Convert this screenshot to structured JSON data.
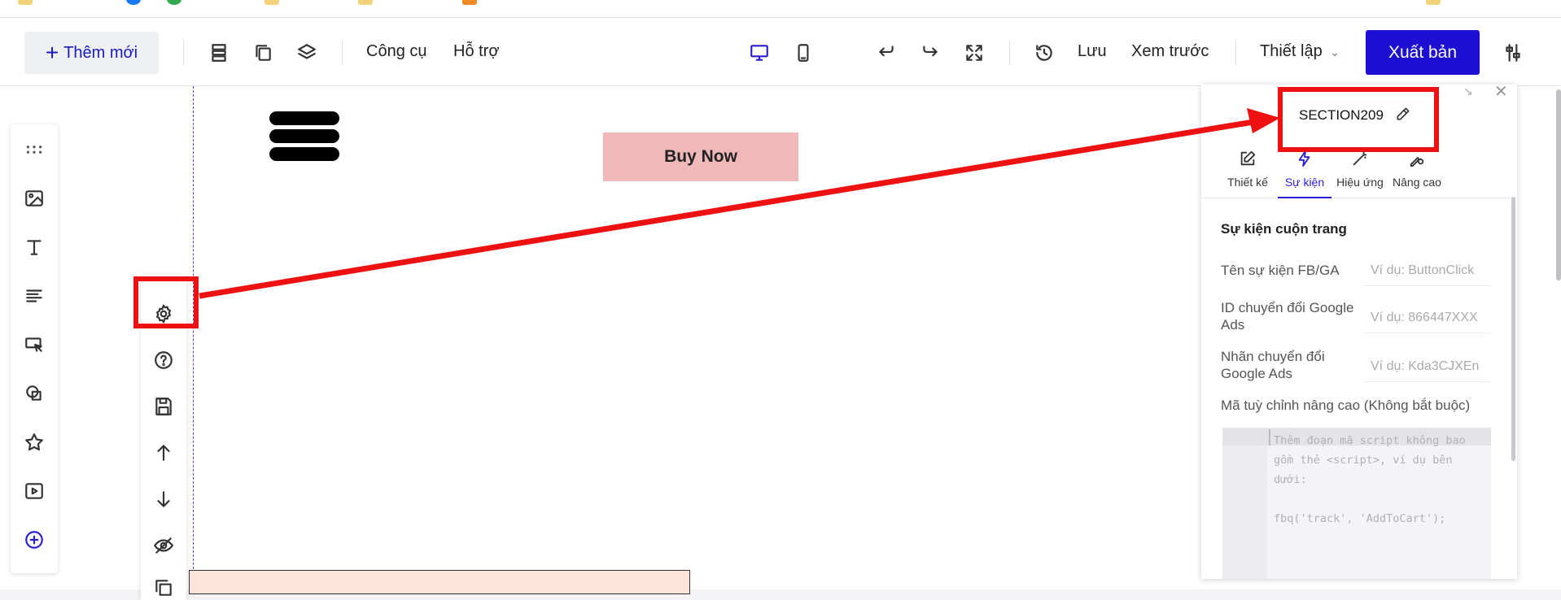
{
  "toolbar": {
    "new_label": "Thêm mới",
    "tools_label": "Công cụ",
    "support_label": "Hỗ trợ",
    "save_label": "Lưu",
    "preview_label": "Xem trước",
    "settings_label": "Thiết lập",
    "publish_label": "Xuất bản"
  },
  "canvas": {
    "buy_button_label": "Buy Now"
  },
  "panel": {
    "section_name": "SECTION209",
    "tabs": [
      {
        "label": "Thiết kế",
        "icon": "edit-icon"
      },
      {
        "label": "Sự kiện",
        "icon": "lightning-icon",
        "active": true
      },
      {
        "label": "Hiệu ứng",
        "icon": "magic-wand-icon"
      },
      {
        "label": "Nâng cao",
        "icon": "gear-pen-icon"
      }
    ],
    "heading": "Sự kiện cuộn trang",
    "fields": [
      {
        "label": "Tên sự kiện FB/GA",
        "placeholder": "Ví dụ: ButtonClick"
      },
      {
        "label": "ID chuyển đổi Google Ads",
        "placeholder": "Ví dụ: 866447XXX"
      },
      {
        "label": "Nhãn chuyển đổi Google Ads",
        "placeholder": "Ví dụ: Kda3CJXEn"
      }
    ],
    "custom_code_label": "Mã tuỳ chỉnh nâng cao (Không bắt buộc)",
    "code_placeholder": "Thêm đoạn mã script không bao gồm thẻ <script>, ví dụ bên dưới:\n\nfbq('track', 'AddToCart');"
  },
  "colors": {
    "accent": "#1d0fd1",
    "annotation": "#ee1111",
    "buy_button_bg": "#f0b8b9"
  }
}
